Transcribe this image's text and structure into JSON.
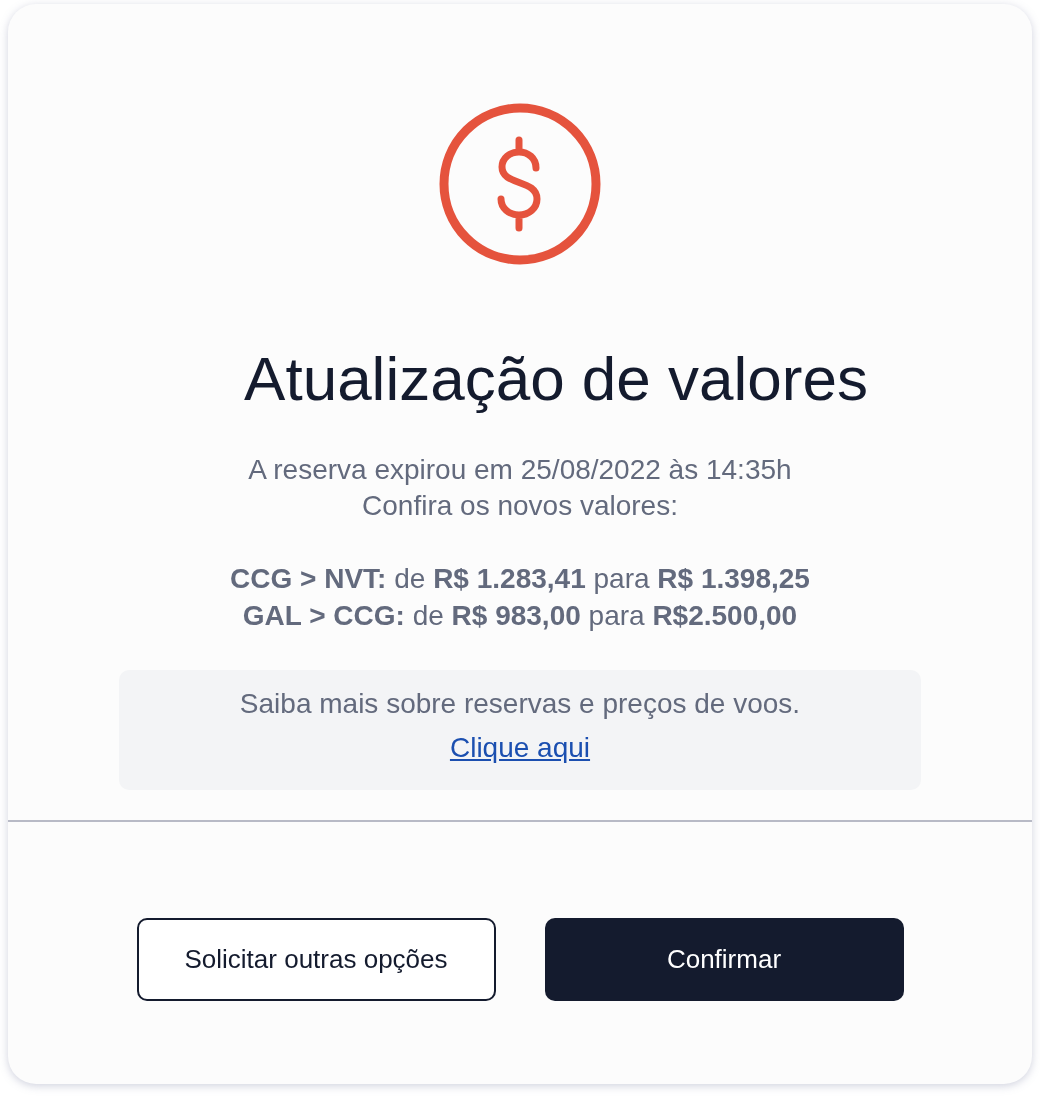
{
  "dialog": {
    "title": "Atualização de valores",
    "message_lines": [
      "A reserva expirou em 25/08/2022 às 14:35h",
      "Confira os novos valores:"
    ],
    "price_changes": [
      "**CCG > NVT:** de **R$ 1.283,41** para **R$ 1.398,25**",
      "**GAL > CCG:** de **R$ 983,00** para **R$2.500,00**"
    ],
    "info": {
      "text": "Saiba mais sobre reservas e preços de voos.",
      "link": "Clique aqui"
    },
    "buttons": [
      {
        "label": "Solicitar outras opções",
        "kind": "secondary"
      },
      {
        "label": "Confirmar",
        "kind": "primary"
      }
    ]
  }
}
